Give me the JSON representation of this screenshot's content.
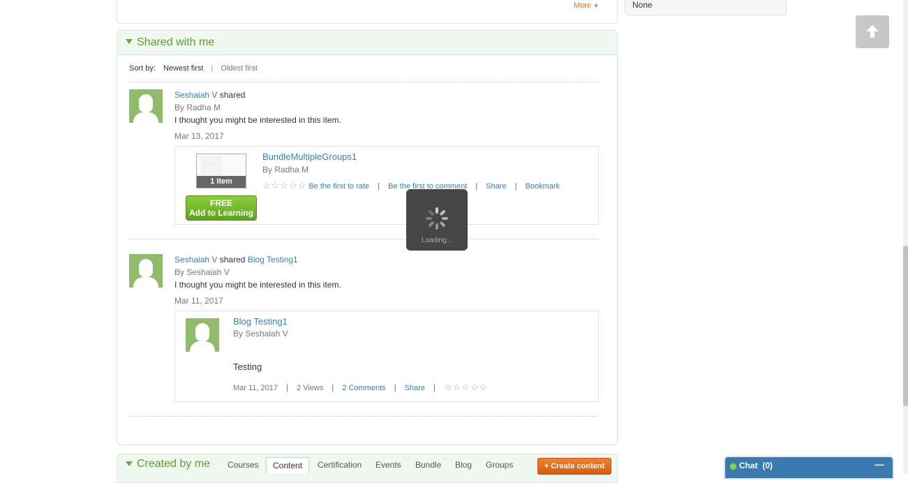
{
  "top": {
    "more_label": "More"
  },
  "sidebar": {
    "value": "None"
  },
  "shared": {
    "title": "Shared with me",
    "sort_label": "Sort by:",
    "sort_options": [
      "Newest first",
      "Oldest first"
    ],
    "items": [
      {
        "actor": "Seshaiah V",
        "action": "shared",
        "byline": "By Radha M",
        "message": "I thought you might be interested in this item.",
        "date": "Mar 13, 2017",
        "content": {
          "title": "BundleMultipleGroups1",
          "byline": "By Radha M",
          "thumb_caption": "1 Item",
          "free_label": "FREE",
          "add_label": "Add to Learning",
          "rate_label": "Be the first to rate",
          "comment_label": "Be the first to comment",
          "share_label": "Share",
          "bookmark_label": "Bookmark",
          "rating": 0
        }
      },
      {
        "actor": "Seshaiah V",
        "action": "shared",
        "target": "Blog Testing1",
        "byline": "By Seshaiah V",
        "message": "I thought you might be interested in this item.",
        "date": "Mar 11, 2017",
        "content": {
          "title": "Blog Testing1",
          "byline": "By Seshaiah V",
          "body": "Testing",
          "date": "Mar 11, 2017",
          "views": "2 Views",
          "comments": "2 Comments",
          "share_label": "Share",
          "rating": 0
        }
      }
    ]
  },
  "loading": {
    "text": "Loading..."
  },
  "created": {
    "title": "Created by me",
    "tabs": [
      "Courses",
      "Content",
      "Certification",
      "Events",
      "Bundle",
      "Blog",
      "Groups"
    ],
    "active_tab": "Content",
    "create_label": "+ Create content"
  },
  "chat": {
    "label": "Chat",
    "count": "(0)"
  },
  "colors": {
    "link": "#3a7fb8",
    "accent_green": "#5a9e2b",
    "orange": "#e8731c",
    "chat_blue": "#3b7ab0"
  }
}
